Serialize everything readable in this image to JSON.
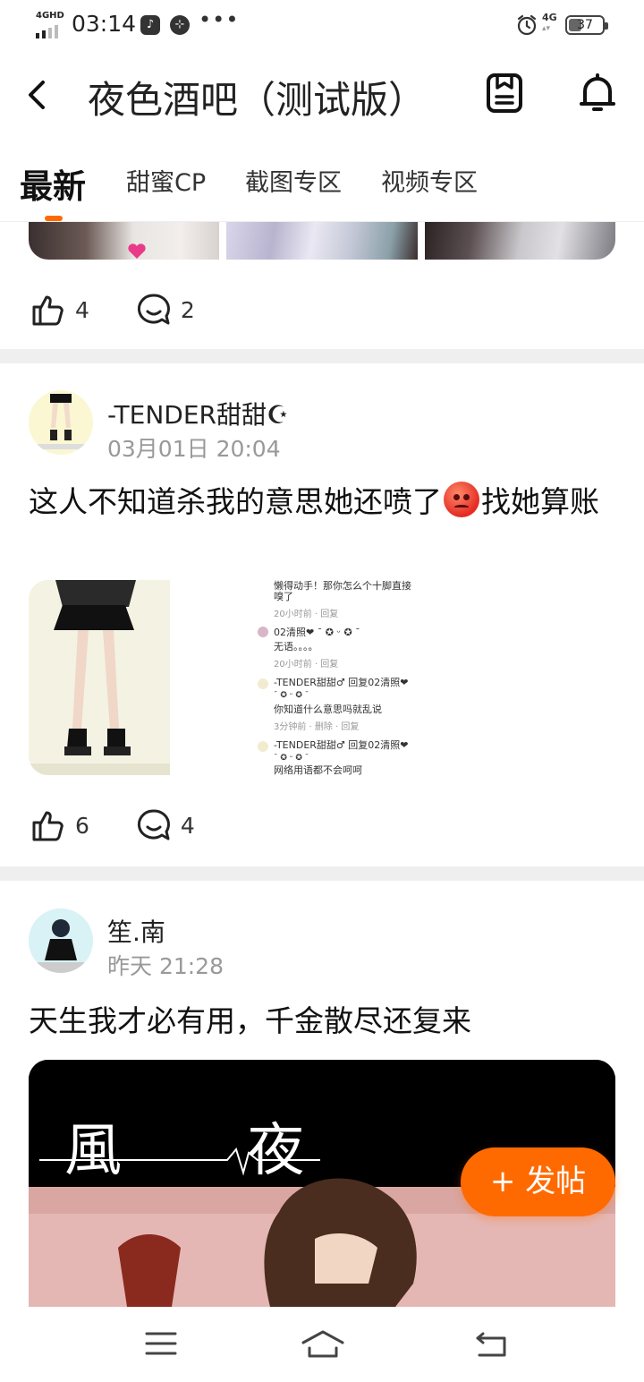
{
  "status_bar": {
    "network_label": "4GHD",
    "time": "03:14",
    "more": "•••",
    "signal_label": "4G",
    "battery": "37"
  },
  "header": {
    "title": "夜色酒吧（测试版）"
  },
  "tabs": [
    {
      "label": "最新",
      "active": true
    },
    {
      "label": "甜蜜CP",
      "active": false
    },
    {
      "label": "截图专区",
      "active": false
    },
    {
      "label": "视频专区",
      "active": false
    }
  ],
  "posts": [
    {
      "likes": "4",
      "comments": "2"
    },
    {
      "username": "-TENDER甜甜☪",
      "time": "03月01日 20:04",
      "text_before": "这人不知道杀我的意思她还喷了",
      "text_after": "找她算账",
      "screenshot_lines": [
        "懒得动手！那你怎么个十脚直接",
        "嗅了",
        "20小时前 · 回复",
        "02清照❤ ¯ ✪ ᵕ ✪ ¯",
        "无语。。。。",
        "20小时前 · 回复",
        "-TENDER甜甜♂ 回复02清照❤",
        "¯ ✪ ᵕ ✪ ¯",
        "你知道什么意思吗就乱说",
        "3分钟前 · 删除 · 回复",
        "-TENDER甜甜♂ 回复02清照❤",
        "¯ ✪ ᵕ ✪ ¯",
        "网络用语都不会呵呵"
      ],
      "likes": "6",
      "comments": "4"
    },
    {
      "username": "笙.南",
      "time": "昨天 21:28",
      "text": "天生我才必有用，千金散尽还复来",
      "image_caption": "風 夜"
    }
  ],
  "fab": {
    "label": "+ 发帖"
  },
  "colors": {
    "accent": "#ff6a00",
    "divider": "#efefef",
    "muted": "#999999"
  }
}
